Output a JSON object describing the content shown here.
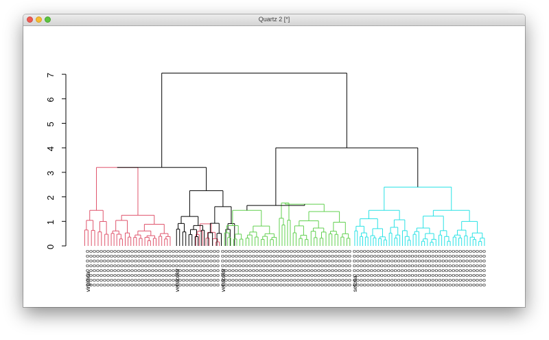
{
  "window": {
    "title": "Quartz 2 [*]"
  },
  "chart_data": {
    "type": "dendrogram",
    "y_ticks": [
      "0",
      "1",
      "2",
      "3",
      "4",
      "5",
      "6",
      "7"
    ],
    "ylim": [
      0,
      7
    ],
    "colors": {
      "root": "#000000",
      "cluster_setosa": "#df536b",
      "cluster_versicolor": "#61d04f",
      "cluster_virginica": "#28e2e5"
    },
    "groups": [
      {
        "color": "#df536b",
        "start": 125,
        "end": 255,
        "label": "virginica"
      },
      {
        "color": "#000000",
        "start": 255,
        "end": 320,
        "label": "versicolor"
      },
      {
        "color": "#61d04f",
        "start": 322,
        "end": 512,
        "label": "versicolor"
      },
      {
        "color": "#28e2e5",
        "start": 514,
        "end": 708,
        "label": "setosa"
      }
    ],
    "leaf_label_rows": 8
  }
}
